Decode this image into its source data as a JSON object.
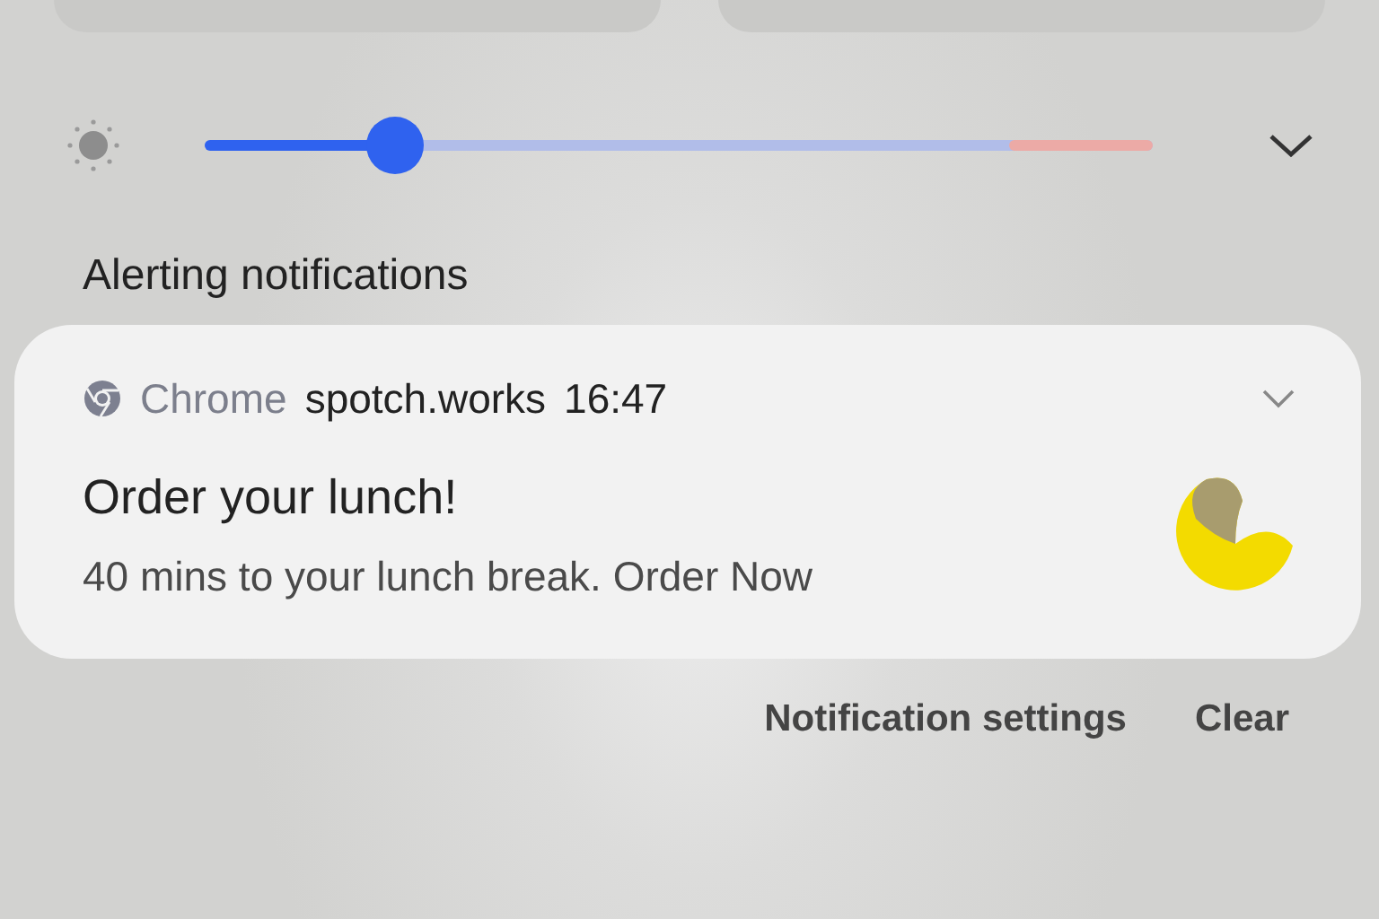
{
  "brightness": {
    "level": 0.2
  },
  "section_title": "Alerting notifications",
  "notification": {
    "app": "Chrome",
    "source": "spotch.works",
    "time": "16:47",
    "expanded": false,
    "title": "Order your lunch!",
    "body": "40 mins to your lunch break. Order Now"
  },
  "actions": [
    "Notification settings",
    "Clear"
  ]
}
